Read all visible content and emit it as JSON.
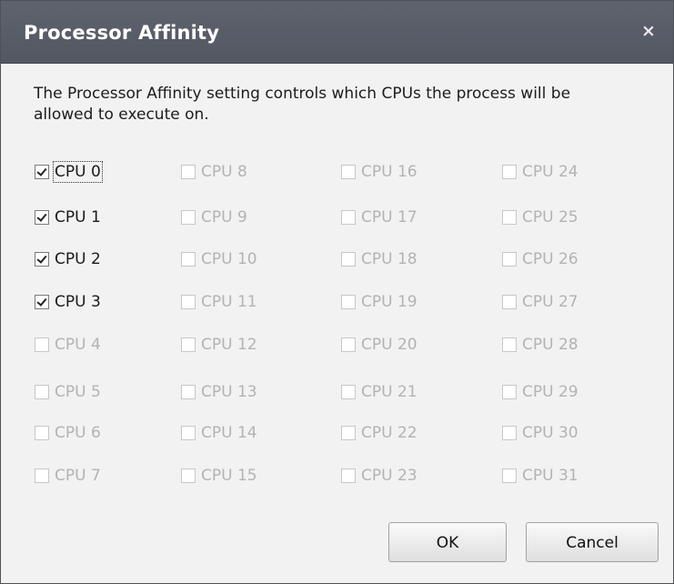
{
  "dialog": {
    "title": "Processor Affinity",
    "close_label": "×",
    "description": "The Processor Affinity setting controls which CPUs the process will be allowed to execute on."
  },
  "cpus": [
    {
      "label": "CPU 0",
      "checked": true,
      "enabled": true,
      "focused": true
    },
    {
      "label": "CPU 1",
      "checked": true,
      "enabled": true
    },
    {
      "label": "CPU 2",
      "checked": true,
      "enabled": true
    },
    {
      "label": "CPU 3",
      "checked": true,
      "enabled": true
    },
    {
      "label": "CPU 4",
      "checked": false,
      "enabled": false
    },
    {
      "label": "CPU 5",
      "checked": false,
      "enabled": false
    },
    {
      "label": "CPU 6",
      "checked": false,
      "enabled": false
    },
    {
      "label": "CPU 7",
      "checked": false,
      "enabled": false
    },
    {
      "label": "CPU 8",
      "checked": false,
      "enabled": false
    },
    {
      "label": "CPU 9",
      "checked": false,
      "enabled": false
    },
    {
      "label": "CPU 10",
      "checked": false,
      "enabled": false
    },
    {
      "label": "CPU 11",
      "checked": false,
      "enabled": false
    },
    {
      "label": "CPU 12",
      "checked": false,
      "enabled": false
    },
    {
      "label": "CPU 13",
      "checked": false,
      "enabled": false
    },
    {
      "label": "CPU 14",
      "checked": false,
      "enabled": false
    },
    {
      "label": "CPU 15",
      "checked": false,
      "enabled": false
    },
    {
      "label": "CPU 16",
      "checked": false,
      "enabled": false
    },
    {
      "label": "CPU 17",
      "checked": false,
      "enabled": false
    },
    {
      "label": "CPU 18",
      "checked": false,
      "enabled": false
    },
    {
      "label": "CPU 19",
      "checked": false,
      "enabled": false
    },
    {
      "label": "CPU 20",
      "checked": false,
      "enabled": false
    },
    {
      "label": "CPU 21",
      "checked": false,
      "enabled": false
    },
    {
      "label": "CPU 22",
      "checked": false,
      "enabled": false
    },
    {
      "label": "CPU 23",
      "checked": false,
      "enabled": false
    },
    {
      "label": "CPU 24",
      "checked": false,
      "enabled": false
    },
    {
      "label": "CPU 25",
      "checked": false,
      "enabled": false
    },
    {
      "label": "CPU 26",
      "checked": false,
      "enabled": false
    },
    {
      "label": "CPU 27",
      "checked": false,
      "enabled": false
    },
    {
      "label": "CPU 28",
      "checked": false,
      "enabled": false
    },
    {
      "label": "CPU 29",
      "checked": false,
      "enabled": false
    },
    {
      "label": "CPU 30",
      "checked": false,
      "enabled": false
    },
    {
      "label": "CPU 31",
      "checked": false,
      "enabled": false
    }
  ],
  "buttons": {
    "ok_label": "OK",
    "cancel_label": "Cancel"
  },
  "colors": {
    "titlebar": "#585d68",
    "title_text": "#ffffff",
    "enabled_text": "#1a1a1a",
    "disabled_text": "#b3b3b3",
    "body": "#f2f2f2"
  }
}
